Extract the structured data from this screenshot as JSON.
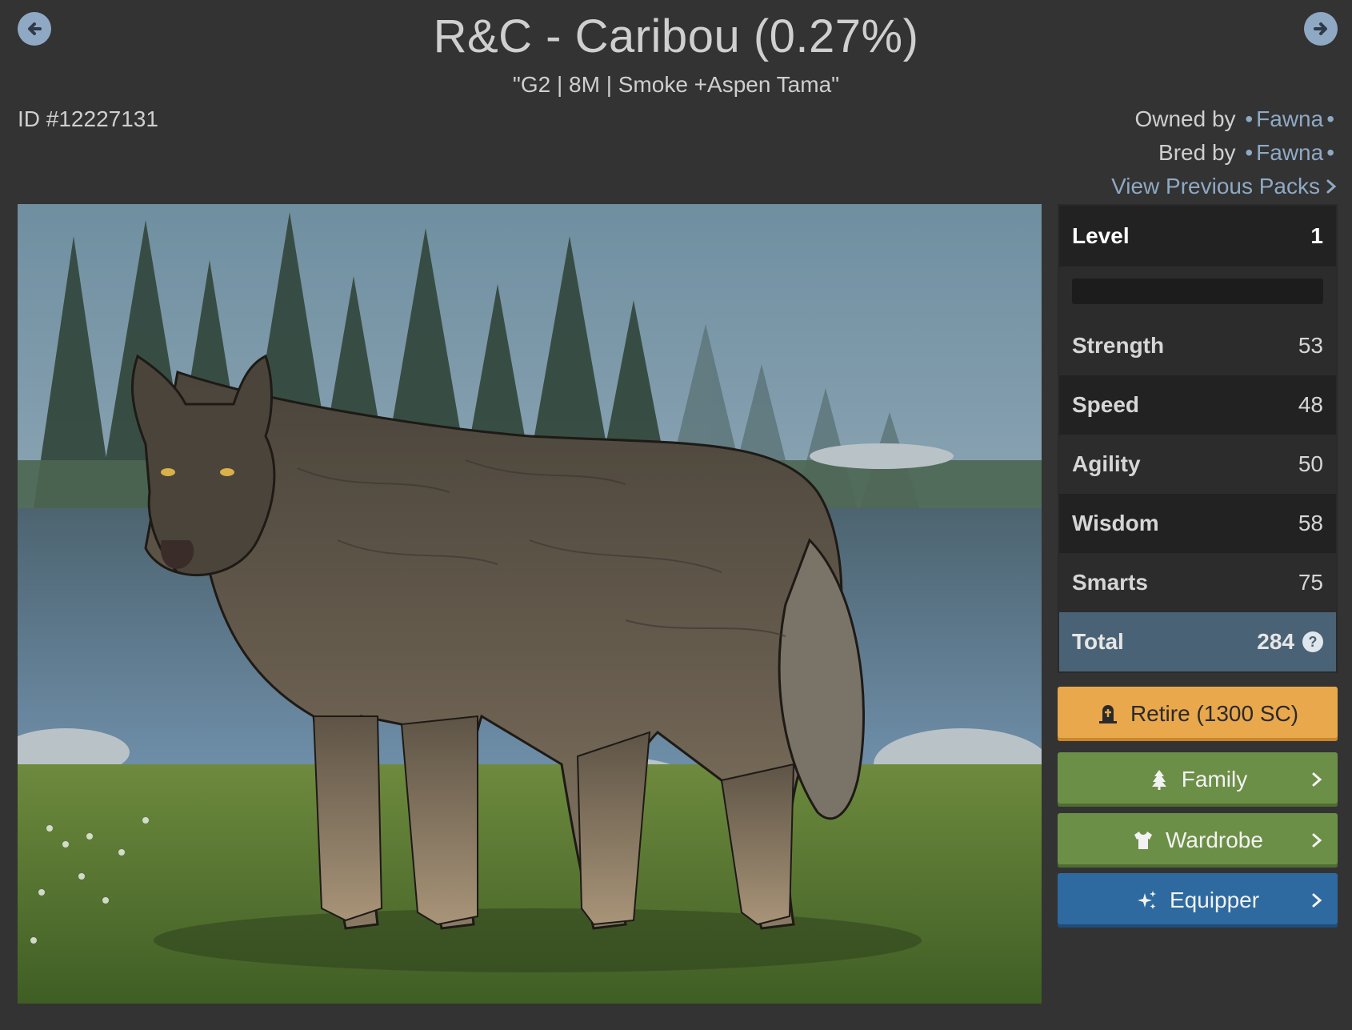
{
  "header": {
    "title": "R&C - Caribou (0.27%)",
    "subtitle": "\"G2 | 8M | Smoke +Aspen Tama\"",
    "id_text": "ID #12227131"
  },
  "nav": {
    "prev_icon": "arrow-left-circle-icon",
    "next_icon": "arrow-right-circle-icon"
  },
  "ownership": {
    "owned_label": "Owned by",
    "owner_name": "Fawna",
    "bred_label": "Bred by",
    "breeder_name": "Fawna",
    "separator": "•",
    "view_packs": "View Previous Packs"
  },
  "stats": {
    "level_label": "Level",
    "level_value": "1",
    "xp_fraction": 0,
    "strength_label": "Strength",
    "strength_value": "53",
    "speed_label": "Speed",
    "speed_value": "48",
    "agility_label": "Agility",
    "agility_value": "50",
    "wisdom_label": "Wisdom",
    "wisdom_value": "58",
    "smarts_label": "Smarts",
    "smarts_value": "75",
    "total_label": "Total",
    "total_value": "284",
    "help_glyph": "?"
  },
  "actions": {
    "retire_label": "Retire (1300 SC)",
    "retire_icon": "gravestone-icon",
    "family_label": "Family",
    "family_icon": "tree-icon",
    "wardrobe_label": "Wardrobe",
    "wardrobe_icon": "shirt-icon",
    "equipper_label": "Equipper",
    "equipper_icon": "sparkles-icon"
  },
  "colors": {
    "background": "#333333",
    "link": "#8fa9c4",
    "retire": "#e9a84c",
    "family": "#6c8f47",
    "wardrobe": "#6c8f47",
    "equipper": "#2e6aa0",
    "total_row": "#4a6275"
  }
}
